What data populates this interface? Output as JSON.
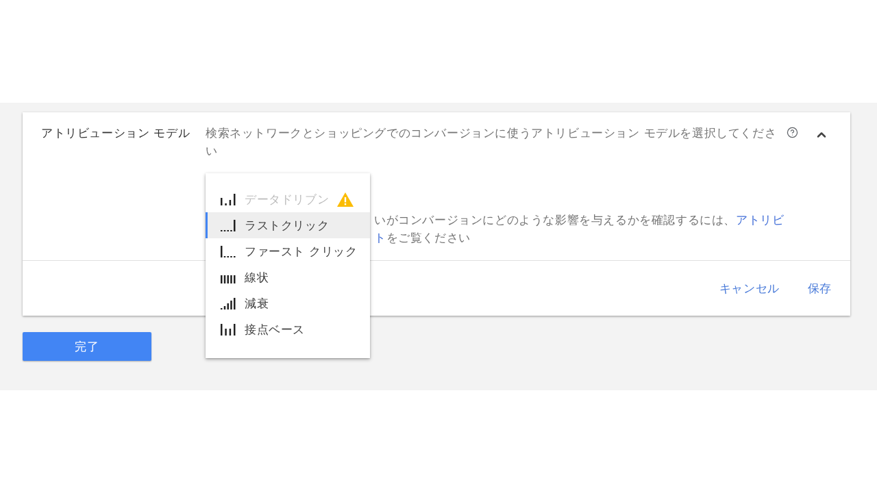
{
  "section": {
    "label": "アトリビューション モデル",
    "description": "検索ネットワークとショッピングでのコンバージョンに使うアトリビューション モデルを選択してください",
    "expanded": true
  },
  "notice": {
    "lines": [
      {
        "segments": [
          {
            "kind": "text",
            "text": "いがコンバージョンにどのような影響を与えるかを確認するには、"
          },
          {
            "kind": "link",
            "text": "アトリビ"
          }
        ]
      },
      {
        "segments": [
          {
            "kind": "link",
            "text": "ト"
          },
          {
            "kind": "text",
            "text": "をご覧ください"
          }
        ]
      }
    ]
  },
  "menu": {
    "items": [
      {
        "kind": "datadriven",
        "label": "データドリブン",
        "selected": false,
        "disabled": true,
        "warning": true
      },
      {
        "kind": "lastclick",
        "label": "ラストクリック",
        "selected": true,
        "disabled": false,
        "warning": false
      },
      {
        "kind": "firstclick",
        "label": "ファースト クリック",
        "selected": false,
        "disabled": false,
        "warning": false
      },
      {
        "kind": "linear",
        "label": "線状",
        "selected": false,
        "disabled": false,
        "warning": false
      },
      {
        "kind": "decay",
        "label": "減衰",
        "selected": false,
        "disabled": false,
        "warning": false
      },
      {
        "kind": "position",
        "label": "接点ベース",
        "selected": false,
        "disabled": false,
        "warning": false
      }
    ]
  },
  "actions": [
    {
      "label": "キャンセル"
    },
    {
      "label": "保存"
    }
  ],
  "done_button": {
    "label": "完了"
  }
}
